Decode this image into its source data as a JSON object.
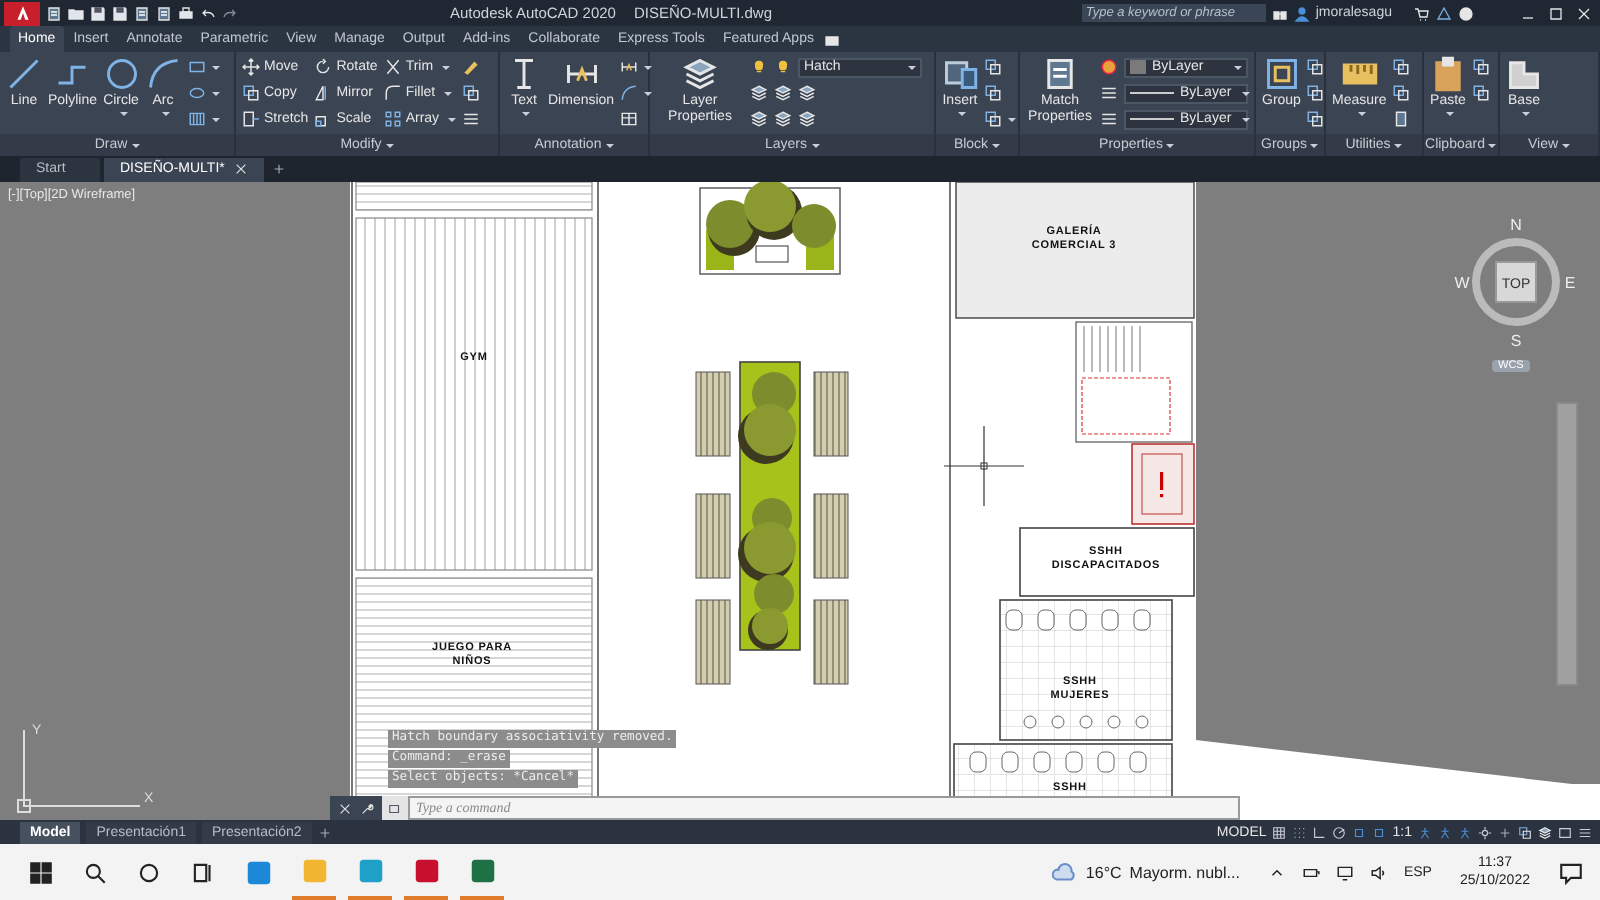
{
  "title_bar": {
    "app_title": "Autodesk AutoCAD 2020",
    "file_name": "DISEÑO-MULTI.dwg",
    "search_placeholder": "Type a keyword or phrase",
    "user_name": "jmoralesagu"
  },
  "ribbon_tabs": [
    {
      "label": "Home",
      "selected": true
    },
    {
      "label": "Insert",
      "selected": false
    },
    {
      "label": "Annotate",
      "selected": false
    },
    {
      "label": "Parametric",
      "selected": false
    },
    {
      "label": "View",
      "selected": false
    },
    {
      "label": "Manage",
      "selected": false
    },
    {
      "label": "Output",
      "selected": false
    },
    {
      "label": "Add-ins",
      "selected": false
    },
    {
      "label": "Collaborate",
      "selected": false
    },
    {
      "label": "Express Tools",
      "selected": false
    },
    {
      "label": "Featured Apps",
      "selected": false
    }
  ],
  "ribbon_panels": [
    {
      "title": "Draw",
      "tools": [
        {
          "kind": "large",
          "label": "Line",
          "dropdown": false
        },
        {
          "kind": "large",
          "label": "Polyline",
          "dropdown": false
        },
        {
          "kind": "large",
          "label": "Circle",
          "dropdown": true
        },
        {
          "kind": "large",
          "label": "Arc",
          "dropdown": true
        },
        {
          "kind": "icon",
          "dropdown": true
        },
        {
          "kind": "icon",
          "dropdown": true
        },
        {
          "kind": "icon",
          "dropdown": true
        }
      ]
    },
    {
      "title": "Modify",
      "tools": [
        {
          "kind": "small",
          "label": "Move",
          "dropdown": false
        },
        {
          "kind": "small",
          "label": "Copy",
          "dropdown": false
        },
        {
          "kind": "small",
          "label": "Stretch",
          "dropdown": false
        },
        {
          "kind": "small",
          "label": "Rotate",
          "dropdown": false
        },
        {
          "kind": "small",
          "label": "Mirror",
          "dropdown": false
        },
        {
          "kind": "small",
          "label": "Scale",
          "dropdown": false
        },
        {
          "kind": "small",
          "label": "Trim",
          "dropdown": true
        },
        {
          "kind": "small",
          "label": "Fillet",
          "dropdown": true
        },
        {
          "kind": "small",
          "label": "Array",
          "dropdown": true
        },
        {
          "kind": "icon",
          "dropdown": false
        },
        {
          "kind": "icon",
          "dropdown": false
        },
        {
          "kind": "icon",
          "dropdown": false
        }
      ]
    },
    {
      "title": "Annotation",
      "tools": [
        {
          "kind": "large",
          "label": "Text",
          "dropdown": true
        },
        {
          "kind": "large",
          "label": "Dimension",
          "dropdown": false
        },
        {
          "kind": "icon",
          "dropdown": true
        },
        {
          "kind": "icon",
          "dropdown": true
        },
        {
          "kind": "icon",
          "dropdown": false
        }
      ]
    },
    {
      "title": "Layers",
      "tools": [
        {
          "kind": "large",
          "label": "Layer Properties",
          "dropdown": false
        },
        {
          "kind": "icon",
          "dropdown": false
        },
        {
          "kind": "icon",
          "dropdown": false
        },
        {
          "kind": "icon",
          "dropdown": false
        },
        {
          "kind": "icon",
          "dropdown": false
        },
        {
          "kind": "icon",
          "dropdown": false
        },
        {
          "kind": "icon",
          "dropdown": false
        },
        {
          "kind": "combo",
          "value": "Hatch"
        },
        {
          "kind": "icon",
          "dropdown": false
        },
        {
          "kind": "icon",
          "dropdown": false
        }
      ]
    },
    {
      "title": "Block",
      "tools": [
        {
          "kind": "large",
          "label": "Insert",
          "dropdown": true
        },
        {
          "kind": "icon",
          "dropdown": false
        },
        {
          "kind": "icon",
          "dropdown": false
        },
        {
          "kind": "icon",
          "dropdown": true
        }
      ]
    },
    {
      "title": "Properties",
      "tools": [
        {
          "kind": "large",
          "label": "Match Properties",
          "dropdown": false
        },
        {
          "kind": "icon",
          "dropdown": false
        },
        {
          "kind": "icon",
          "dropdown": false
        },
        {
          "kind": "icon",
          "dropdown": false
        },
        {
          "kind": "color-combo",
          "value": "ByLayer"
        },
        {
          "kind": "line-combo",
          "value": "ByLayer"
        },
        {
          "kind": "line-combo",
          "value": "ByLayer"
        }
      ]
    },
    {
      "title": "Groups",
      "tools": [
        {
          "kind": "large",
          "label": "Group",
          "dropdown": false
        },
        {
          "kind": "icon",
          "dropdown": false
        },
        {
          "kind": "icon",
          "dropdown": false
        },
        {
          "kind": "icon",
          "dropdown": false
        }
      ]
    },
    {
      "title": "Utilities",
      "tools": [
        {
          "kind": "large",
          "label": "Measure",
          "dropdown": true
        },
        {
          "kind": "icon",
          "dropdown": false
        },
        {
          "kind": "icon",
          "dropdown": false
        },
        {
          "kind": "icon",
          "dropdown": false
        }
      ]
    },
    {
      "title": "Clipboard",
      "tools": [
        {
          "kind": "large",
          "label": "Paste",
          "dropdown": true
        },
        {
          "kind": "icon",
          "dropdown": false
        },
        {
          "kind": "icon",
          "dropdown": false
        }
      ]
    },
    {
      "title": "View",
      "tools": [
        {
          "kind": "large",
          "label": "Base",
          "dropdown": true
        }
      ]
    }
  ],
  "file_tabs": [
    {
      "label": "Start",
      "selected": false,
      "closable": false
    },
    {
      "label": "DISEÑO-MULTI*",
      "selected": true,
      "closable": true
    }
  ],
  "viewport": {
    "label": "[-][Top][2D Wireframe]"
  },
  "viewcube": {
    "north": "N",
    "south": "S",
    "west": "W",
    "east": "E",
    "face": "TOP",
    "ucs": "WCS"
  },
  "ucs_axes": {
    "y": "Y",
    "x": "X"
  },
  "rooms": [
    {
      "lines": [
        "GALERÍA",
        "COMERCIAL 3"
      ]
    },
    {
      "lines": [
        "GYM"
      ]
    },
    {
      "lines": [
        "SSHH",
        "DISCAPACITADOS"
      ]
    },
    {
      "lines": [
        "JUEGO PARA",
        "NIÑOS"
      ]
    },
    {
      "lines": [
        "SSHH",
        "MUJERES"
      ]
    },
    {
      "lines": [
        "SSHH"
      ]
    }
  ],
  "command_history": [
    "Hatch boundary associativity removed.",
    "Command: _erase",
    "Select objects: *Cancel*"
  ],
  "command_line": {
    "placeholder": "Type a command"
  },
  "layout_tabs": [
    {
      "label": "Model",
      "selected": true
    },
    {
      "label": "Presentación1",
      "selected": false
    },
    {
      "label": "Presentación2",
      "selected": false
    }
  ],
  "status_bar": {
    "space": "MODEL",
    "scale": "1:1"
  },
  "taskbar": {
    "apps": [
      {
        "running": false
      },
      {
        "running": true
      },
      {
        "running": true
      },
      {
        "running": true
      },
      {
        "running": true
      }
    ],
    "temperature": "16°C",
    "weather": "Mayorm. nubl...",
    "language": "ESP",
    "time": "11:37",
    "date": "25/10/2022"
  }
}
